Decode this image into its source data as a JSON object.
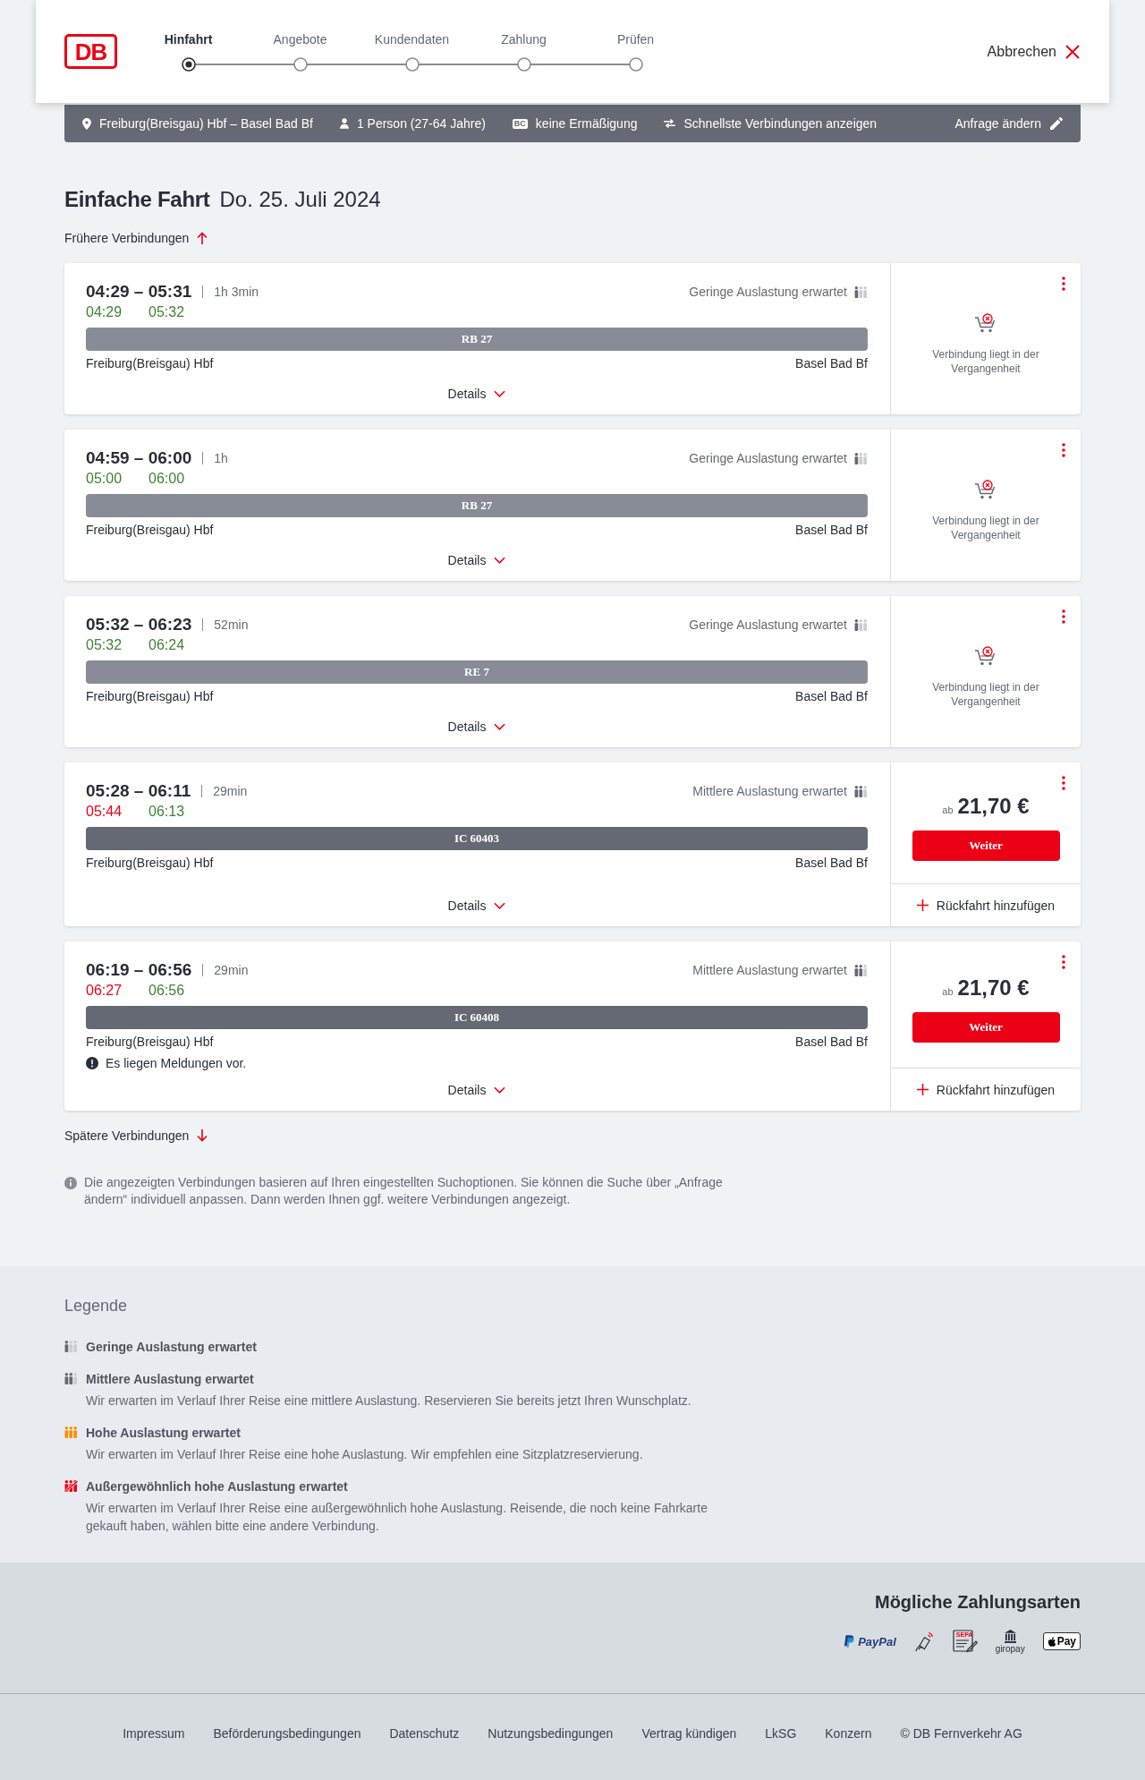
{
  "header": {
    "logo": "DB",
    "steps": [
      {
        "label": "Hinfahrt",
        "selected": true
      },
      {
        "label": "Angebote",
        "selected": false
      },
      {
        "label": "Kundendaten",
        "selected": false
      },
      {
        "label": "Zahlung",
        "selected": false
      },
      {
        "label": "Prüfen",
        "selected": false
      }
    ],
    "cancel": "Abbrechen"
  },
  "search_summary": {
    "route": "Freiburg(Breisgau) Hbf – Basel Bad Bf",
    "travellers": "1 Person (27-64 Jahre)",
    "discount_badge": "BC",
    "discount": "keine Ermäßigung",
    "option": "Schnellste Verbindungen anzeigen",
    "edit": "Anfrage ändern"
  },
  "heading": {
    "title": "Einfache Fahrt",
    "date": "Do. 25. Juli 2024"
  },
  "earlier_link": "Frühere Verbindungen",
  "connections": [
    {
      "kind": "past",
      "planned": "04:29 – 05:31",
      "duration": "1h 3min",
      "departure": {
        "time": "04:29",
        "delayed": false
      },
      "arrival": {
        "time": "05:32",
        "delayed": false
      },
      "occupancy": {
        "kind": "low",
        "label": "Geringe Auslastung erwartet"
      },
      "train": {
        "kind": "regional",
        "label": "RB 27"
      },
      "from": "Freiburg(Breisgau) Hbf",
      "to": "Basel Bad Bf",
      "details": "Details",
      "status": "Verbindung liegt in der Vergangenheit"
    },
    {
      "kind": "past",
      "planned": "04:59 – 06:00",
      "duration": "1h",
      "departure": {
        "time": "05:00",
        "delayed": false
      },
      "arrival": {
        "time": "06:00",
        "delayed": false
      },
      "occupancy": {
        "kind": "low",
        "label": "Geringe Auslastung erwartet"
      },
      "train": {
        "kind": "regional",
        "label": "RB 27"
      },
      "from": "Freiburg(Breisgau) Hbf",
      "to": "Basel Bad Bf",
      "details": "Details",
      "status": "Verbindung liegt in der Vergangenheit"
    },
    {
      "kind": "past",
      "planned": "05:32 – 06:23",
      "duration": "52min",
      "departure": {
        "time": "05:32",
        "delayed": false
      },
      "arrival": {
        "time": "06:24",
        "delayed": false
      },
      "occupancy": {
        "kind": "low",
        "label": "Geringe Auslastung erwartet"
      },
      "train": {
        "kind": "regional",
        "label": "RE 7"
      },
      "from": "Freiburg(Breisgau) Hbf",
      "to": "Basel Bad Bf",
      "details": "Details",
      "status": "Verbindung liegt in der Vergangenheit"
    },
    {
      "kind": "bookable",
      "planned": "05:28 – 06:11",
      "duration": "29min",
      "departure": {
        "time": "05:44",
        "delayed": true
      },
      "arrival": {
        "time": "06:13",
        "delayed": false
      },
      "occupancy": {
        "kind": "medium",
        "label": "Mittlere Auslastung erwartet"
      },
      "train": {
        "kind": "long_distance",
        "label": "IC 60403"
      },
      "from": "Freiburg(Breisgau) Hbf",
      "to": "Basel Bad Bf",
      "details": "Details",
      "price_prefix": "ab",
      "price": "21,70 €",
      "button": "Weiter",
      "return_link": "Rückfahrt hinzufügen"
    },
    {
      "kind": "bookable",
      "planned": "06:19 – 06:56",
      "duration": "29min",
      "departure": {
        "time": "06:27",
        "delayed": true
      },
      "arrival": {
        "time": "06:56",
        "delayed": false
      },
      "occupancy": {
        "kind": "medium",
        "label": "Mittlere Auslastung erwartet"
      },
      "train": {
        "kind": "long_distance",
        "label": "IC 60408"
      },
      "from": "Freiburg(Breisgau) Hbf",
      "to": "Basel Bad Bf",
      "notice": "Es liegen Meldungen vor.",
      "details": "Details",
      "price_prefix": "ab",
      "price": "21,70 €",
      "button": "Weiter",
      "return_link": "Rückfahrt hinzufügen"
    }
  ],
  "later_link": "Spätere Verbindungen",
  "info": "Die angezeigten Verbindungen basieren auf Ihren eingestellten Suchoptionen. Sie können die Suche über „Anfrage ändern“ individuell anpassen. Dann werden Ihnen ggf. weitere Verbindungen angezeigt.",
  "legend": {
    "title": "Legende",
    "items": [
      {
        "kind": "low",
        "title": "Geringe Auslastung erwartet"
      },
      {
        "kind": "medium",
        "title": "Mittlere Auslastung erwartet",
        "description": "Wir erwarten im Verlauf Ihrer Reise eine mittlere Auslastung. Reservieren Sie bereits jetzt Ihren Wunschplatz."
      },
      {
        "kind": "high",
        "title": "Hohe Auslastung erwartet",
        "description": "Wir erwarten im Verlauf Ihrer Reise eine hohe Auslastung. Wir empfehlen eine Sitzplatzreservierung."
      },
      {
        "kind": "extreme",
        "title": "Außergewöhnlich hohe Auslastung erwartet",
        "description": "Wir erwarten im Verlauf Ihrer Reise eine außergewöhnlich hohe Auslastung. Reisende, die noch keine Fahrkarte gekauft haben, wählen bitte eine andere Verbindung."
      }
    ]
  },
  "payment": {
    "title": "Mögliche Zahlungsarten",
    "methods": [
      {
        "kind": "paypal",
        "label": "PayPal"
      },
      {
        "kind": "contactless"
      },
      {
        "kind": "sepa",
        "label": "SEPA"
      },
      {
        "kind": "giropay",
        "label": "giropay"
      },
      {
        "kind": "applepay",
        "label": "Pay"
      }
    ]
  },
  "footer": {
    "links": [
      "Impressum",
      "Beförderungsbedingungen",
      "Datenschutz",
      "Nutzungsbedingungen",
      "Vertrag kündigen",
      "LkSG",
      "Konzern"
    ],
    "copyright": "© DB Fernverkehr AG"
  }
}
